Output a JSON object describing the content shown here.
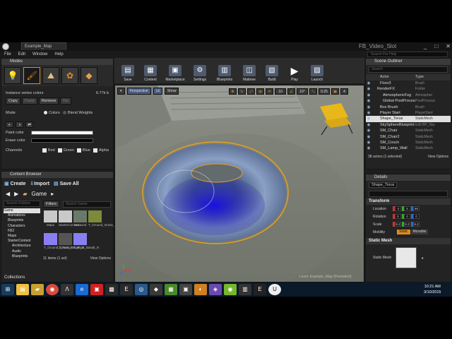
{
  "window": {
    "map_tab": "Example_Map",
    "project_name": "FB_Video_Slot",
    "controls": [
      "_",
      "□",
      "✕"
    ]
  },
  "menu": {
    "items": [
      "File",
      "Edit",
      "Window",
      "Help"
    ],
    "search_placeholder": "Search For Help"
  },
  "modes": {
    "title": "Modes",
    "instance_label": "Instance vertex colors",
    "instance_size": "6.77k b",
    "buttons": [
      "Copy",
      "Paste",
      "Remove",
      "Fix"
    ],
    "mode_label": "Mode",
    "mode_colors": "Colors",
    "mode_blend": "Blend Weights",
    "paint_color": "Paint color",
    "erase_color": "Erase color",
    "channels_label": "Channels",
    "channels": [
      "Red",
      "Green",
      "Blue",
      "Alpha"
    ]
  },
  "toolbar": {
    "buttons": [
      "Save",
      "Content",
      "Marketplace",
      "Settings",
      "Blueprints",
      "Matinee",
      "Build",
      "Play",
      "Launch"
    ]
  },
  "viewport": {
    "perspective": "Perspective",
    "lit": "Lit",
    "show": "Show",
    "snap_value": "0.25",
    "cam_speed": "4",
    "level_label": "Level: Example_Map (Persistent)"
  },
  "outliner": {
    "title": "Scene Outliner",
    "search_placeholder": "Search",
    "col_actor": "Actor",
    "col_type": "Type",
    "rows": [
      {
        "name": "Floor3",
        "type": "Brush"
      },
      {
        "name": "RenderFX",
        "type": "Folder"
      },
      {
        "name": "AtmosphericFog",
        "type": "Atmospher"
      },
      {
        "name": "Global PostProcess",
        "type": "PostProcess"
      },
      {
        "name": "Box Brush",
        "type": "Brush"
      },
      {
        "name": "Player Start",
        "type": "PlayerStart"
      },
      {
        "name": "Shape_Torus",
        "type": "StaticMesh"
      },
      {
        "name": "SkySphereBlueprint",
        "type": "Edit BP_Sky"
      },
      {
        "name": "SM_Chair",
        "type": "StaticMesh"
      },
      {
        "name": "SM_Chair2",
        "type": "StaticMesh"
      },
      {
        "name": "SM_Couch",
        "type": "StaticMesh"
      },
      {
        "name": "SM_Lamp_Wall",
        "type": "StaticMesh"
      }
    ],
    "selected_index": 6,
    "count_label": "38 actors (1 selected)",
    "view_options": "View Options"
  },
  "details": {
    "title": "Details",
    "object_name": "Shape_Torus",
    "transform_title": "Transform",
    "location_label": "Location",
    "location": [
      "-2",
      "5",
      "50"
    ],
    "rotation_label": "Rotation",
    "rotation": [
      "0",
      "0",
      "0"
    ],
    "scale_label": "Scale",
    "scale": [
      "9.2",
      "9.2",
      "9.2"
    ],
    "mobility_label": "Mobility",
    "mobility": [
      "Static",
      "Movable"
    ],
    "static_mesh_title": "Static Mesh",
    "static_mesh_label": "Static Mesh"
  },
  "content_browser": {
    "title": "Content Browser",
    "create": "Create",
    "import": "Import",
    "save_all": "Save All",
    "path": "Game",
    "search_folders": "Search Folders",
    "filters": "Filters",
    "search_game": "Search Game",
    "tree": [
      "Game",
      "Animations",
      "Blueprints",
      "Characters",
      "FB2",
      "Maps",
      "StarterContent",
      "Architecture",
      "Audio",
      "Blueprints"
    ],
    "assets": [
      "Maps",
      "StarterContent",
      "Unsaved",
      "T_Ground_Grass_D",
      "T_Ground_Grass_N",
      "T_Rock_Basalt_D",
      "T_Rock_Basalt_N"
    ],
    "count_label": "11 items (1 sel)",
    "view_options": "View Options",
    "collections": "Collections"
  },
  "taskbar": {
    "time": "10:21 AM",
    "date": "3/10/2015"
  },
  "colors": {
    "accent": "#e28b1c",
    "selection": "#e0e0e0",
    "panel": "#232323"
  }
}
